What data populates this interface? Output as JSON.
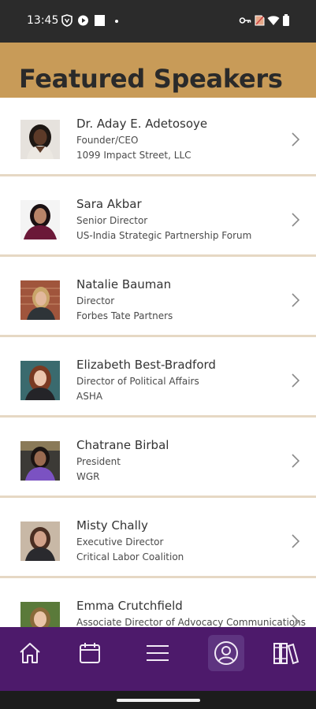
{
  "status_bar": {
    "time": "13:45",
    "left_icons": [
      "vpn-shield-icon",
      "play-icon",
      "square-icon",
      "dot-icon"
    ],
    "right_icons": [
      "key-icon",
      "no-sim-icon",
      "wifi-icon",
      "battery-icon"
    ]
  },
  "header": {
    "title": "Featured Speakers",
    "background_color": "#c89b58"
  },
  "speakers": [
    {
      "name": "Dr. Aday E. Adetosoye",
      "title": "Founder/CEO",
      "organization": "1099 Impact Street, LLC"
    },
    {
      "name": "Sara Akbar",
      "title": "Senior Director",
      "organization": "US-India Strategic Partnership Forum"
    },
    {
      "name": "Natalie Bauman",
      "title": "Director",
      "organization": "Forbes Tate Partners"
    },
    {
      "name": "Elizabeth Best-Bradford",
      "title": "Director of Political Affairs",
      "organization": "ASHA"
    },
    {
      "name": "Chatrane Birbal",
      "title": "President",
      "organization": "WGR"
    },
    {
      "name": "Misty Chally",
      "title": "Executive Director",
      "organization": "Critical Labor Coalition"
    },
    {
      "name": "Emma Crutchfield",
      "title": "Associate Director of Advocacy Communications",
      "organization": ""
    }
  ],
  "bottom_nav": {
    "background_color": "#4d1a6b",
    "items": [
      {
        "icon": "home-icon",
        "active": false
      },
      {
        "icon": "calendar-icon",
        "active": false
      },
      {
        "icon": "menu-icon",
        "active": false
      },
      {
        "icon": "profile-icon",
        "active": true
      },
      {
        "icon": "library-icon",
        "active": false
      }
    ]
  }
}
